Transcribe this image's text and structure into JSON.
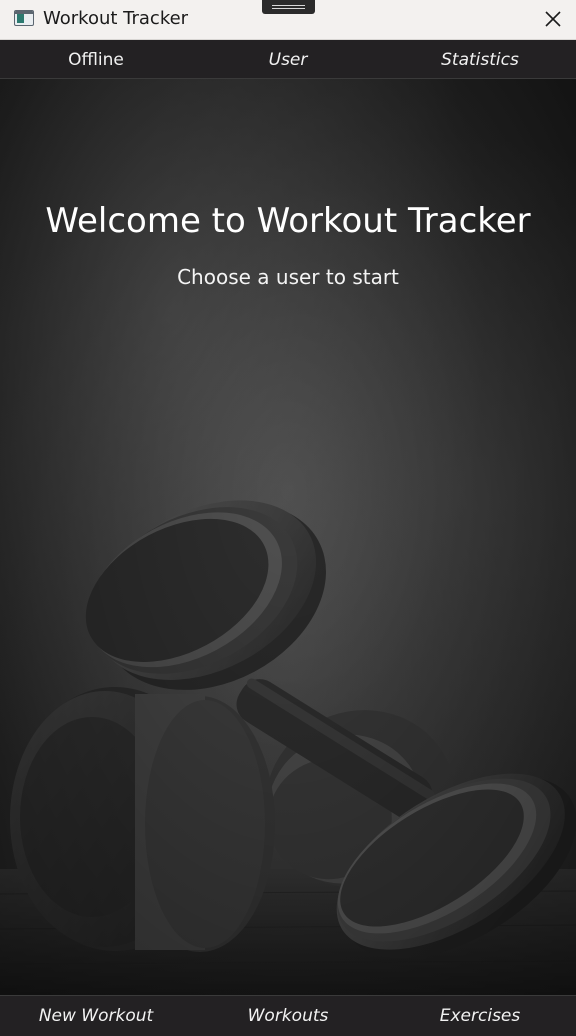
{
  "window": {
    "title": "Workout Tracker",
    "icon": "app-window-icon",
    "close_icon": "close-icon"
  },
  "top_nav": {
    "items": [
      {
        "label": "Offline"
      },
      {
        "label": "User"
      },
      {
        "label": "Statistics"
      }
    ]
  },
  "hero": {
    "title": "Welcome to Workout Tracker",
    "subtitle": "Choose a user to start",
    "background_image": "dumbbells-photo"
  },
  "bottom_nav": {
    "items": [
      {
        "label": "New Workout"
      },
      {
        "label": "Workouts"
      },
      {
        "label": "Exercises"
      }
    ]
  },
  "colors": {
    "nav_background": "#232123",
    "title_bar_background": "#f3f1ef",
    "text_light": "#ffffff"
  }
}
